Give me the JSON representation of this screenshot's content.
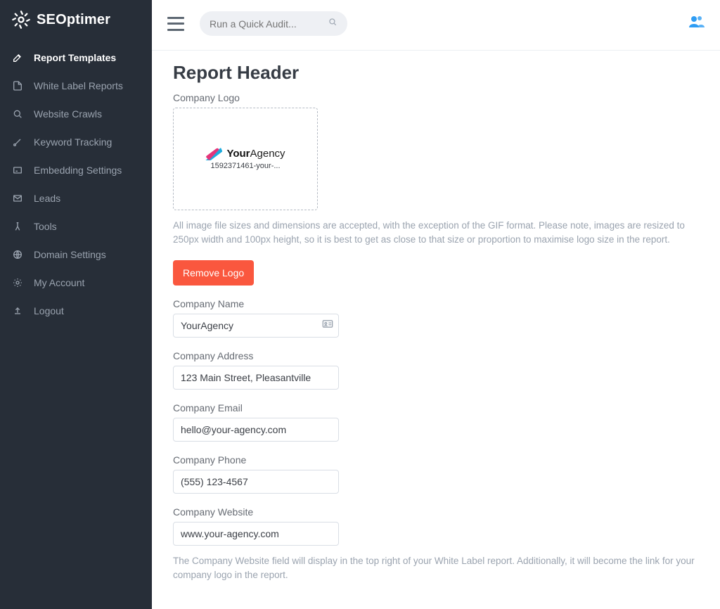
{
  "app": {
    "brand": "SEOptimer",
    "search_placeholder": "Run a Quick Audit..."
  },
  "sidebar": {
    "items": [
      {
        "label": "Report Templates",
        "icon": "edit-icon",
        "active": true
      },
      {
        "label": "White Label Reports",
        "icon": "doc-icon"
      },
      {
        "label": "Website Crawls",
        "icon": "magnify-icon"
      },
      {
        "label": "Keyword Tracking",
        "icon": "key-icon"
      },
      {
        "label": "Embedding Settings",
        "icon": "embed-icon"
      },
      {
        "label": "Leads",
        "icon": "mail-icon"
      },
      {
        "label": "Tools",
        "icon": "tools-icon"
      },
      {
        "label": "Domain Settings",
        "icon": "globe-icon"
      },
      {
        "label": "My Account",
        "icon": "gear-icon"
      },
      {
        "label": "Logout",
        "icon": "upload-icon"
      }
    ]
  },
  "page": {
    "title": "Report Header",
    "company_logo_label": "Company Logo",
    "logo_name_bold": "Your",
    "logo_name_light": "Agency",
    "logo_caption": "1592371461-your-...",
    "logo_note": "All image file sizes and dimensions are accepted, with the exception of the GIF format. Please note, images are resized to 250px width and 100px height, so it is best to get as close to that size or proportion to maximise logo size in the report.",
    "remove_logo_label": "Remove Logo",
    "company_name_label": "Company Name",
    "company_name_value": "YourAgency",
    "company_address_label": "Company Address",
    "company_address_value": "123 Main Street, Pleasantville",
    "company_email_label": "Company Email",
    "company_email_value": "hello@your-agency.com",
    "company_phone_label": "Company Phone",
    "company_phone_value": "(555) 123-4567",
    "company_website_label": "Company Website",
    "company_website_value": "www.your-agency.com",
    "website_note": "The Company Website field will display in the top right of your White Label report. Additionally, it will become the link for your company logo in the report."
  }
}
